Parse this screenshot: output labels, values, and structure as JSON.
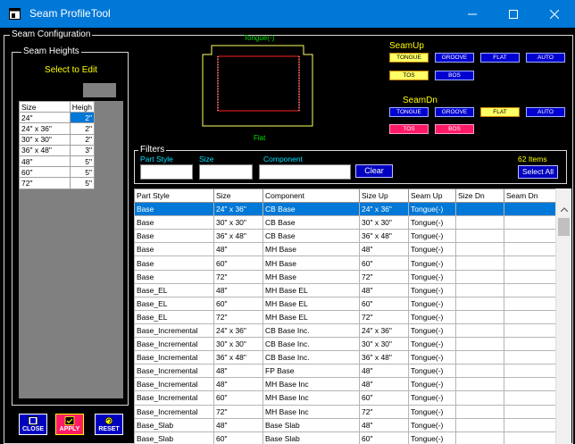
{
  "window": {
    "title": "Seam ProfileTool"
  },
  "seam_config": {
    "legend": "Seam Configuration"
  },
  "seam_heights": {
    "legend": "Seam Heights",
    "select_label": "Select to Edit",
    "headers": [
      "Size",
      "Heigh"
    ],
    "rows": [
      [
        "24\"",
        "2\""
      ],
      [
        "24\" x 36\"",
        "2\""
      ],
      [
        "30\" x 30\"",
        "2\""
      ],
      [
        "36\" x 48\"",
        "3\""
      ],
      [
        "48\"",
        "5\""
      ],
      [
        "60\"",
        "5\""
      ],
      [
        "72\"",
        "5\""
      ]
    ]
  },
  "buttons": {
    "close": "CLOSE",
    "apply": "APPLY",
    "reset": "RESET"
  },
  "preview": {
    "top_label": "Tongue(-)",
    "bottom_label": "Flat"
  },
  "seam_up": {
    "label": "SeamUp",
    "buttons": [
      "TONGUE",
      "GROOVE",
      "FLAT",
      "AUTO",
      "TOS",
      "BOS"
    ]
  },
  "seam_dn": {
    "label": "SeamDn",
    "buttons": [
      "TONGUE",
      "GROOVE",
      "FLAT",
      "AUTO",
      "TOS",
      "BOS"
    ]
  },
  "filters": {
    "legend": "Filters",
    "part_style_label": "Part Style",
    "size_label": "Size",
    "component_label": "Component",
    "clear": "Clear",
    "items_count": "62 Items",
    "select_all": "Select All"
  },
  "grid": {
    "headers": [
      "Part Style",
      "Size",
      "Component",
      "Size Up",
      "Seam Up",
      "Size Dn",
      "Seam Dn"
    ],
    "rows": [
      [
        "Base",
        "24\" x 36\"",
        "CB Base",
        "24\" x 36\"",
        "Tongue(-)",
        "",
        ""
      ],
      [
        "Base",
        "30\" x 30\"",
        "CB Base",
        "30\" x 30\"",
        "Tongue(-)",
        "",
        ""
      ],
      [
        "Base",
        "36\" x 48\"",
        "CB Base",
        "36\" x 48\"",
        "Tongue(-)",
        "",
        ""
      ],
      [
        "Base",
        "48\"",
        "MH Base",
        "48\"",
        "Tongue(-)",
        "",
        ""
      ],
      [
        "Base",
        "60\"",
        "MH Base",
        "60\"",
        "Tongue(-)",
        "",
        ""
      ],
      [
        "Base",
        "72\"",
        "MH Base",
        "72\"",
        "Tongue(-)",
        "",
        ""
      ],
      [
        "Base_EL",
        "48\"",
        "MH Base EL",
        "48\"",
        "Tongue(-)",
        "",
        ""
      ],
      [
        "Base_EL",
        "60\"",
        "MH Base EL",
        "60\"",
        "Tongue(-)",
        "",
        ""
      ],
      [
        "Base_EL",
        "72\"",
        "MH Base EL",
        "72\"",
        "Tongue(-)",
        "",
        ""
      ],
      [
        "Base_Incremental",
        "24\" x 36\"",
        "CB Base Inc.",
        "24\" x 36\"",
        "Tongue(-)",
        "",
        ""
      ],
      [
        "Base_Incremental",
        "30\" x 30\"",
        "CB Base Inc.",
        "30\" x 30\"",
        "Tongue(-)",
        "",
        ""
      ],
      [
        "Base_Incremental",
        "36\" x 48\"",
        "CB Base Inc.",
        "36\" x 48\"",
        "Tongue(-)",
        "",
        ""
      ],
      [
        "Base_Incremental",
        "48\"",
        "FP Base",
        "48\"",
        "Tongue(-)",
        "",
        ""
      ],
      [
        "Base_Incremental",
        "48\"",
        "MH Base Inc",
        "48\"",
        "Tongue(-)",
        "",
        ""
      ],
      [
        "Base_Incremental",
        "60\"",
        "MH Base Inc",
        "60\"",
        "Tongue(-)",
        "",
        ""
      ],
      [
        "Base_Incremental",
        "72\"",
        "MH Base Inc",
        "72\"",
        "Tongue(-)",
        "",
        ""
      ],
      [
        "Base_Slab",
        "48\"",
        "Base Slab",
        "48\"",
        "Tongue(-)",
        "",
        ""
      ],
      [
        "Base_Slab",
        "60\"",
        "Base Slab",
        "60\"",
        "Tongue(-)",
        "",
        ""
      ]
    ]
  }
}
